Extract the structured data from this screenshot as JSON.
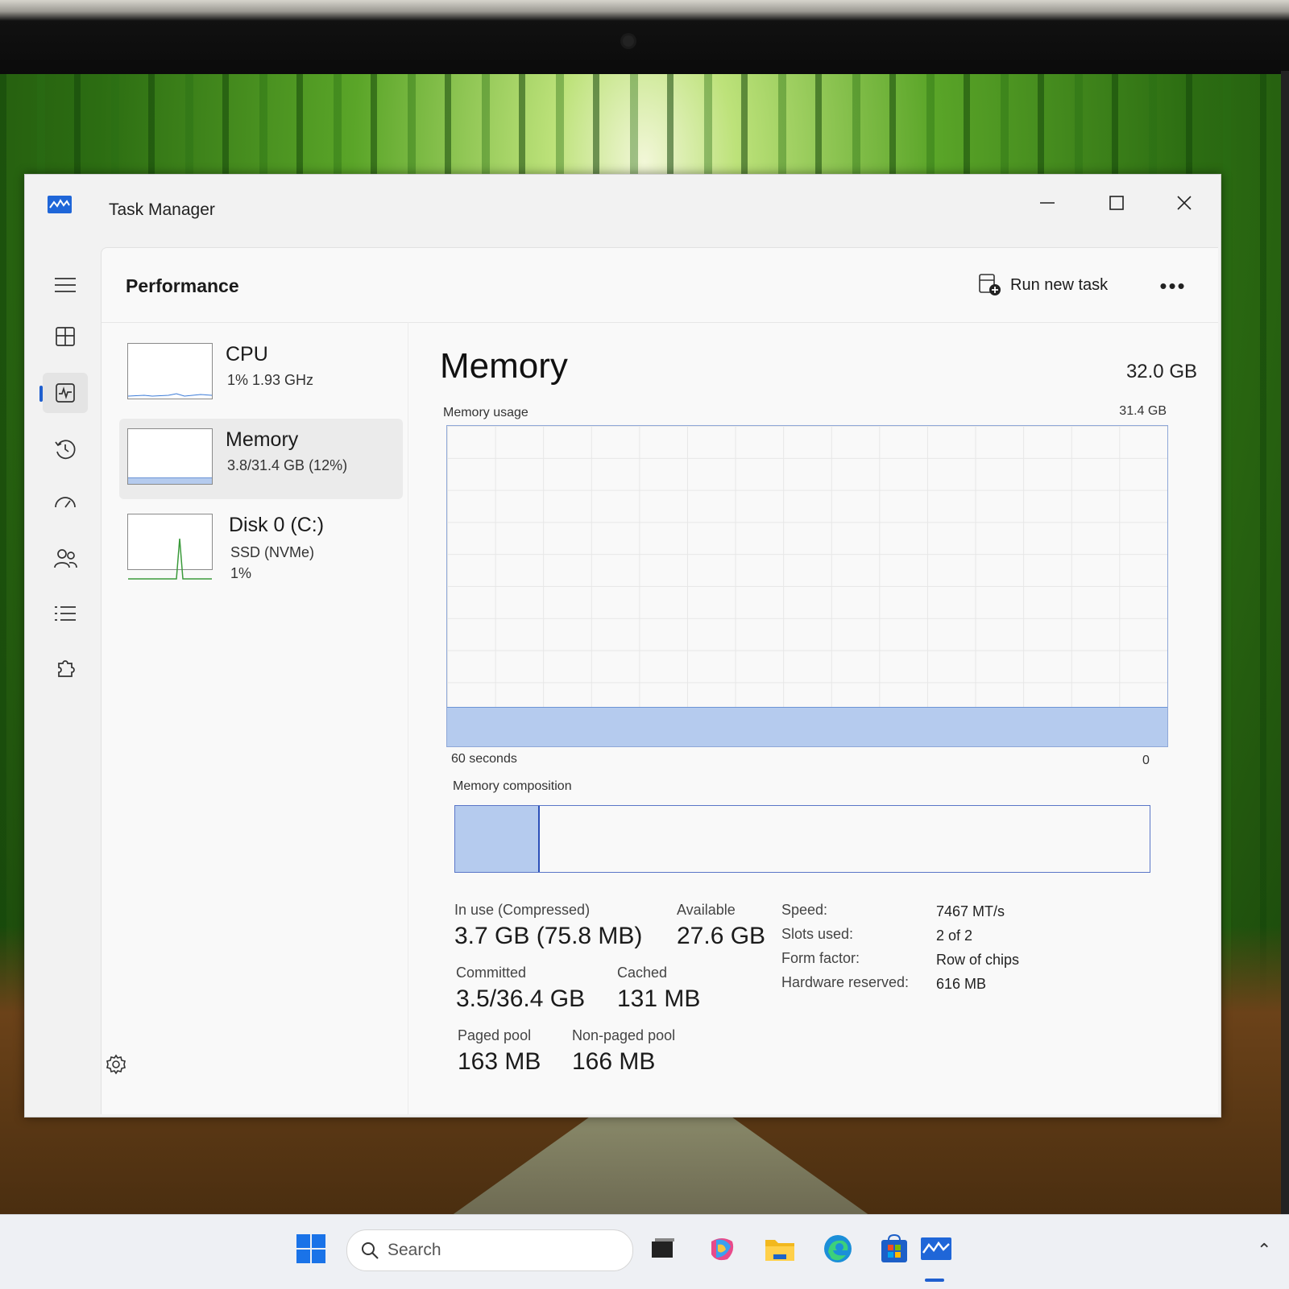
{
  "window": {
    "title": "Task Manager"
  },
  "header": {
    "page_title": "Performance",
    "run_new_task_label": "Run new task"
  },
  "devices": [
    {
      "name": "CPU",
      "detail": "1%  1.93 GHz",
      "detail2": ""
    },
    {
      "name": "Memory",
      "detail": "3.8/31.4 GB (12%)",
      "detail2": ""
    },
    {
      "name": "Disk 0 (C:)",
      "detail": "SSD (NVMe)",
      "detail2": "1%"
    }
  ],
  "memory": {
    "title": "Memory",
    "total": "32.0 GB",
    "usage_label": "Memory usage",
    "usage_max": "31.4 GB",
    "usage_fraction": 0.12,
    "x_left_label": "60 seconds",
    "x_right_label": "0",
    "composition_label": "Memory composition",
    "composition_in_use_fraction": 0.12,
    "stats": {
      "in_use_label": "In use (Compressed)",
      "in_use_value": "3.7 GB (75.8 MB)",
      "available_label": "Available",
      "available_value": "27.6 GB",
      "committed_label": "Committed",
      "committed_value": "3.5/36.4 GB",
      "cached_label": "Cached",
      "cached_value": "131 MB",
      "paged_pool_label": "Paged pool",
      "paged_pool_value": "163 MB",
      "nonpaged_pool_label": "Non-paged pool",
      "nonpaged_pool_value": "166 MB"
    },
    "specs": [
      {
        "key": "Speed:",
        "value": "7467 MT/s"
      },
      {
        "key": "Slots used:",
        "value": "2 of 2"
      },
      {
        "key": "Form factor:",
        "value": "Row of chips"
      },
      {
        "key": "Hardware reserved:",
        "value": "616 MB"
      }
    ]
  },
  "taskbar": {
    "search_placeholder": "Search"
  },
  "colors": {
    "accent": "#1f5fcf",
    "memory_fill": "#b5cbee",
    "memory_line": "#2b4fb8",
    "disk_spike": "#3a9a3a"
  }
}
